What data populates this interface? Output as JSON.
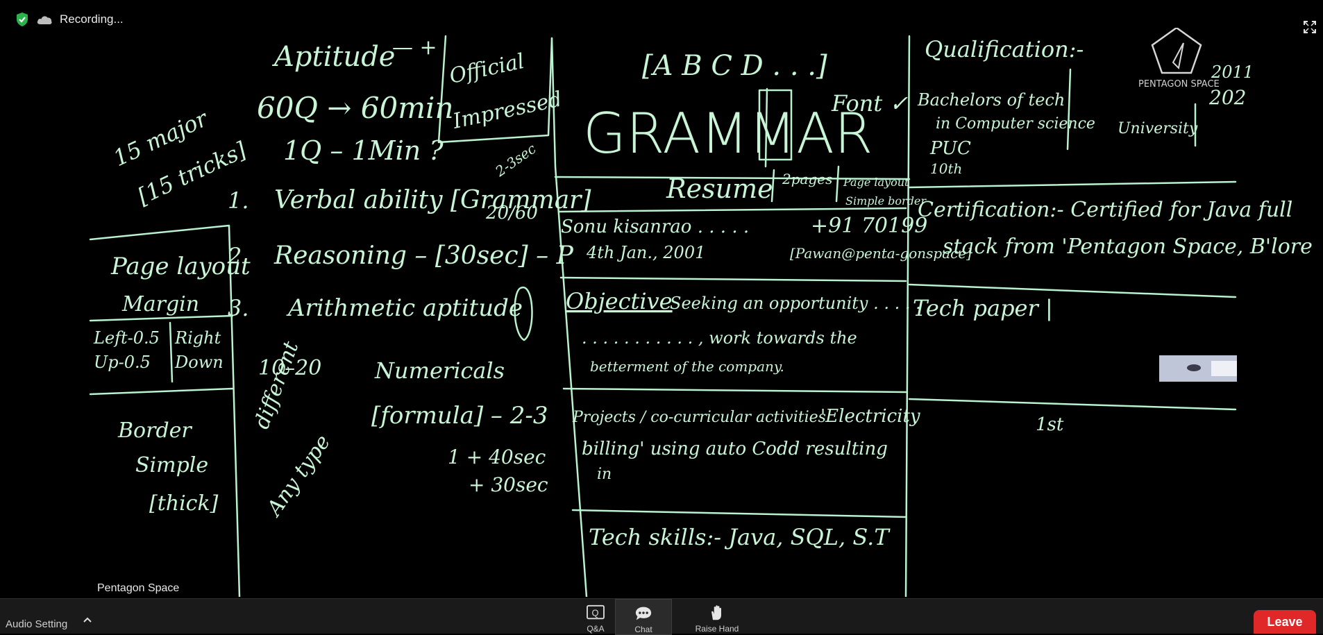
{
  "status": {
    "recording_label": "Recording..."
  },
  "speaker": {
    "name": "Pentagon Space"
  },
  "board": {
    "aptitude": [
      "Aptitude",
      "60Q → 60min",
      "1Q – 1Min ?",
      "15 major",
      "[15 tricks]"
    ],
    "topics": [
      "1.",
      "Verbal ability [Grammar]",
      "2.",
      "Reasoning – [30sec] – P",
      "3.",
      "Arithmetic aptitude",
      "Numericals",
      "[formula] – 2-3",
      "1 + 40sec",
      "+ 30sec",
      "10–20",
      "different",
      "Any type",
      "2-3sec",
      "20/60"
    ],
    "official": [
      "Official",
      "Impressed"
    ],
    "page_layout": [
      "Page layout",
      "Margin",
      "Left-0.5",
      "Right",
      "Up-0.5",
      "Down",
      "Border",
      "Simple",
      "[thick]"
    ],
    "resume": {
      "abcd": "[A B C D . . .]",
      "grammar": "GRAMMAR",
      "font": "Font ✓",
      "resume_title": "Resume",
      "pages": "2pages",
      "page_layout_note": "Page layout",
      "simple_border": "Simple border",
      "name_line": "Sonu kisanrao . . . . .",
      "phone": "+91 70199",
      "dob": "4th Jan., 2001",
      "email": "[Pawan@penta-gonspace]",
      "objective_label": "Objective",
      "objective_text": "Seeking an opportunity . . . . .",
      "objective_text2": ". . . . . . . . . . . , work towards the",
      "objective_text3": "betterment of the company.",
      "projects_label": "Projects / co-curricular activities",
      "projects_text": "'Electricity",
      "projects_text2": "billing' using auto Codd resulting",
      "projects_text3": "in",
      "tech_skills": "Tech skills:- Java, SQL, S.T"
    },
    "qualification": {
      "title": "Qualification:-",
      "bachelors": "Bachelors of tech",
      "bachelors2": "in Computer science",
      "puc": "PUC",
      "tenth": "10th",
      "university": "University",
      "year1": "2011",
      "year2": "202",
      "certification": "Certification:- Certified for Java full",
      "certification2": "stack from 'Pentagon Space, B'lore",
      "tech_paper": "Tech paper |",
      "misc": "1st"
    },
    "logo": {
      "name": "PENTAGON SPACE"
    }
  },
  "bottombar": {
    "audio_setting": "Audio Setting",
    "qa_label": "Q&A",
    "chat_label": "Chat",
    "raise_hand_label": "Raise Hand",
    "leave_label": "Leave"
  },
  "colors": {
    "chalk": "#b9f2cf",
    "leave": "#e02828",
    "shield": "#2bb24c"
  }
}
